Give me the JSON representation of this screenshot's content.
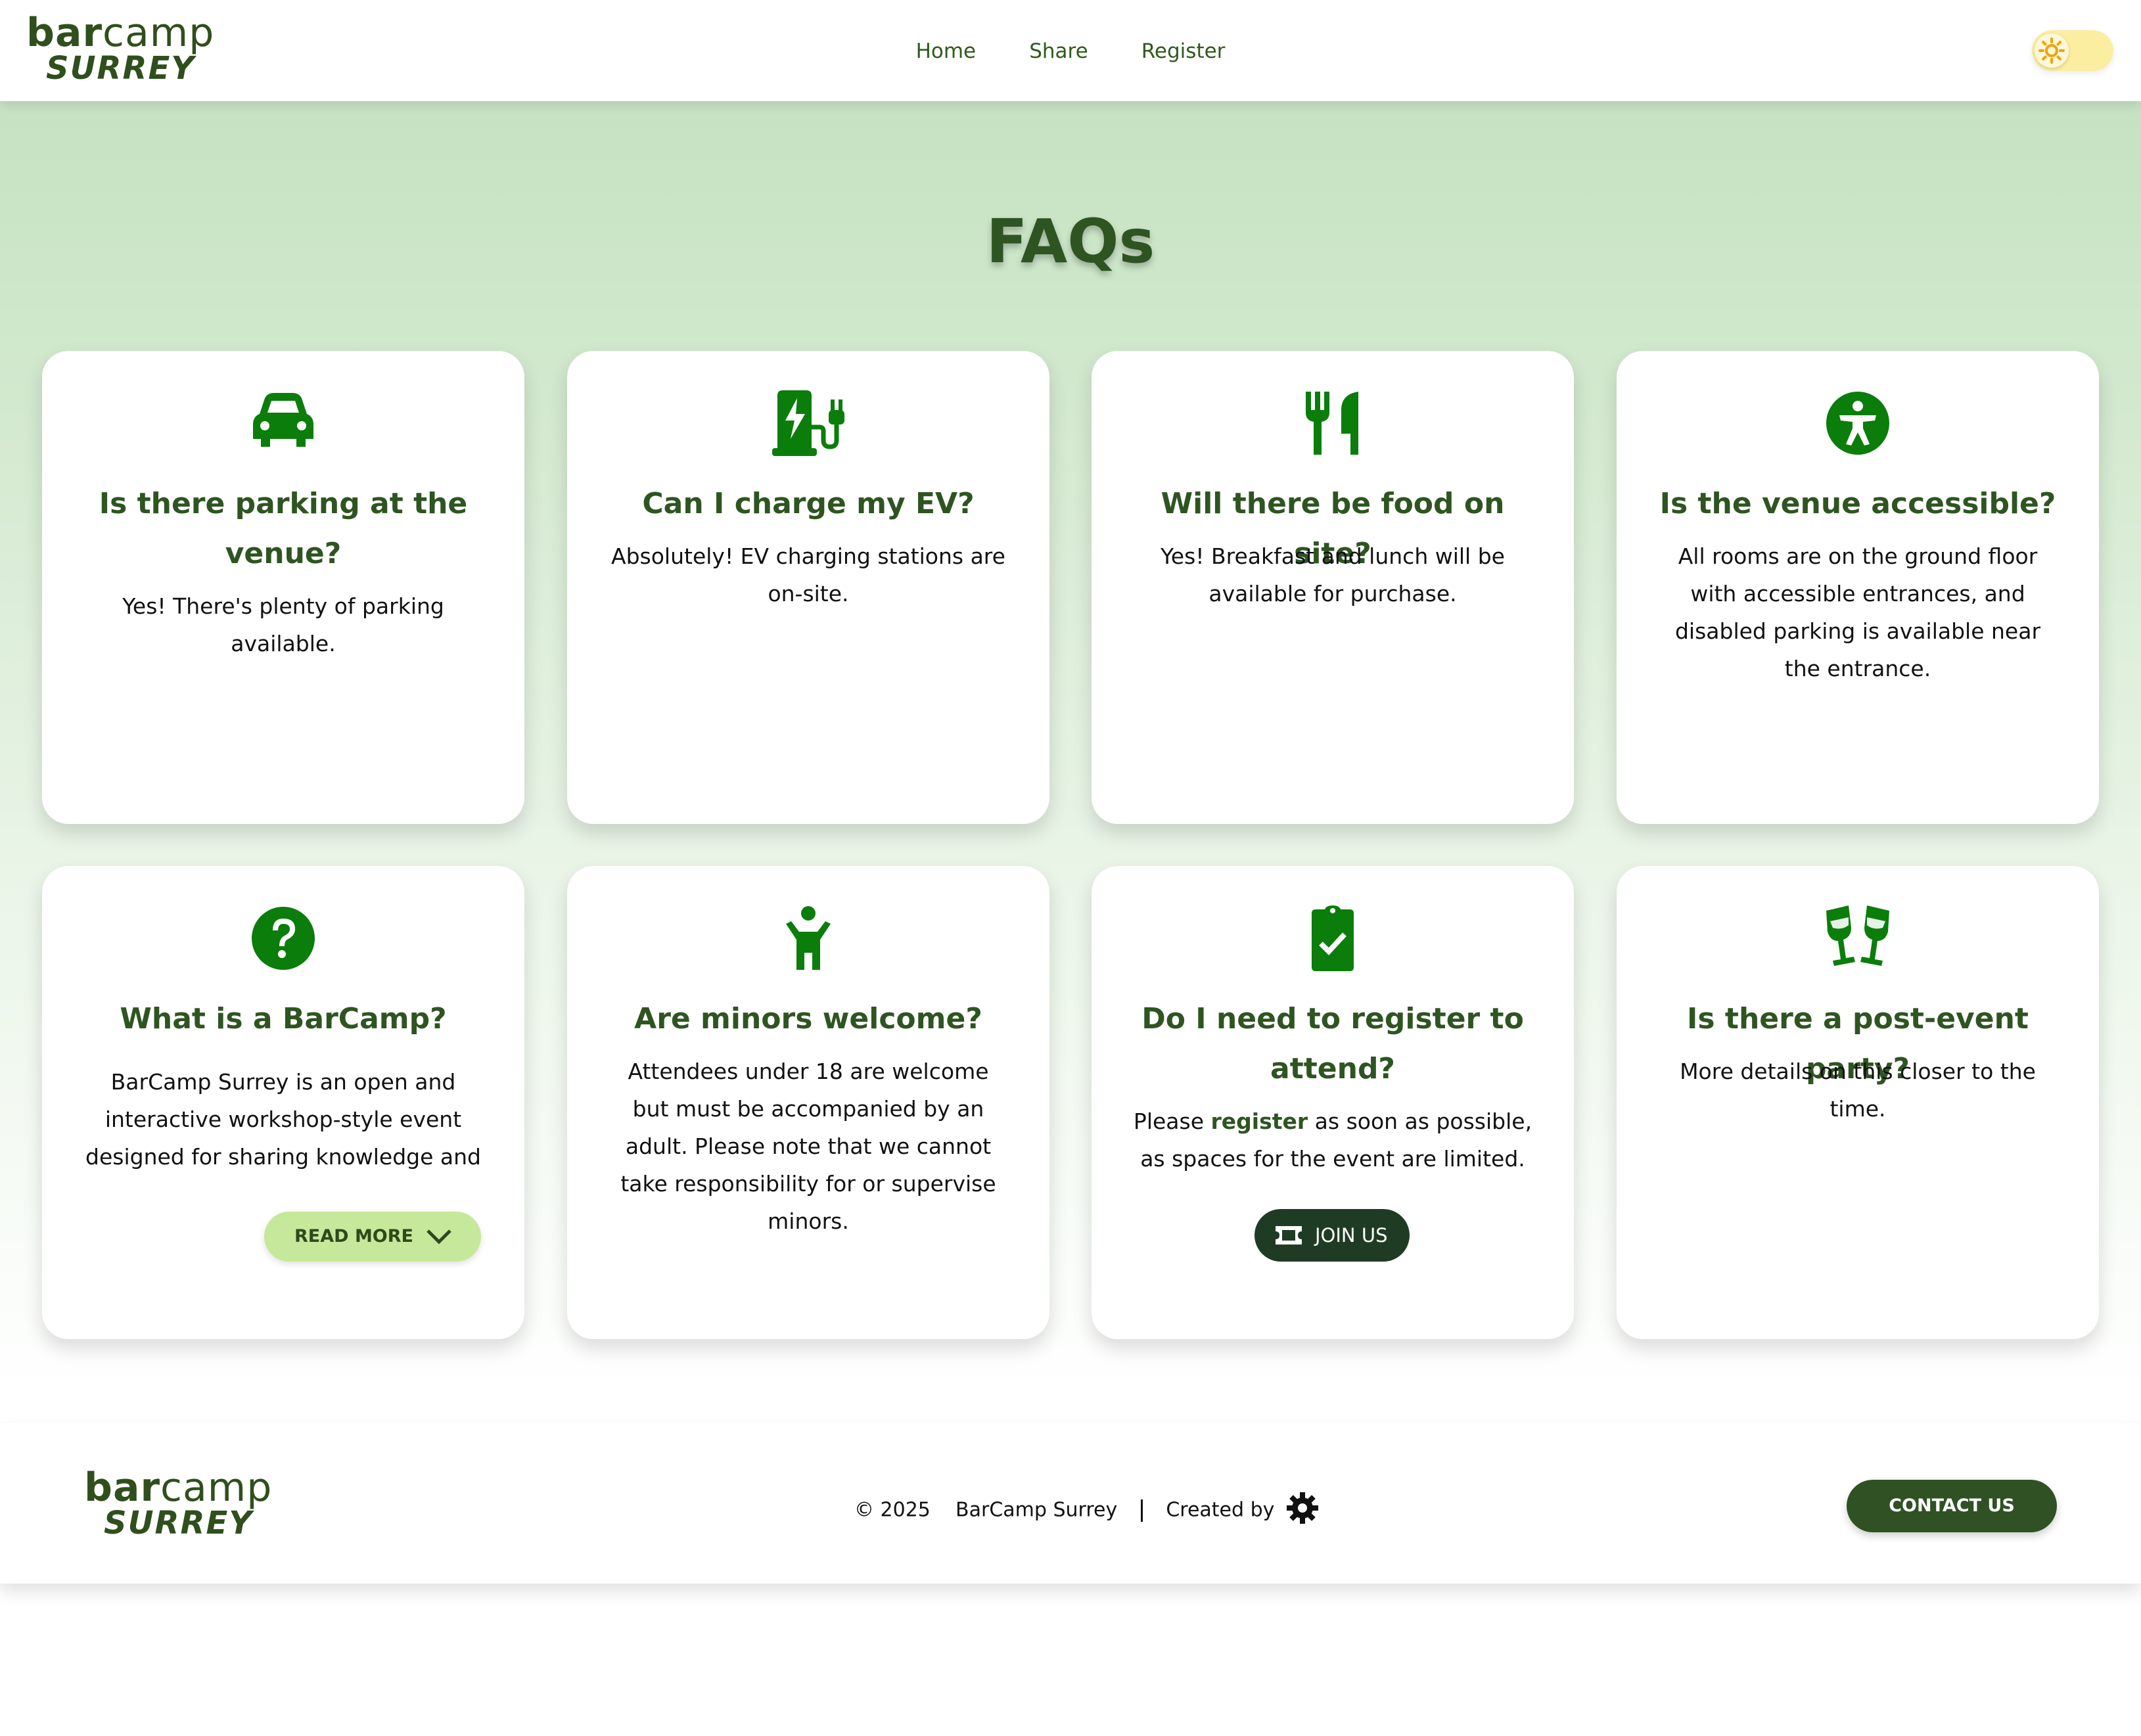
{
  "header": {
    "logo_top": "bar",
    "logo_top_rest": "camp",
    "logo_bottom": "SURREY",
    "nav": [
      "Home",
      "Share",
      "Register"
    ]
  },
  "main": {
    "title": "FAQs",
    "cards": [
      {
        "icon": "car-icon",
        "question": "Is there parking at the venue?",
        "answer": "Yes! There's plenty of parking available."
      },
      {
        "icon": "ev-charger-icon",
        "question": "Can I charge my EV?",
        "answer": "Absolutely! EV charging stations are on-site."
      },
      {
        "icon": "utensils-icon",
        "question": "Will there be food on site?",
        "answer": "Yes! Breakfast and lunch will be available for purchase."
      },
      {
        "icon": "accessibility-icon",
        "question": "Is the venue accessible?",
        "answer": "All rooms are on the ground floor with accessible entrances, and disabled parking is available near the entrance."
      },
      {
        "icon": "question-circle-icon",
        "question": "What is a BarCamp?",
        "answer": "BarCamp Surrey is an open and interactive workshop-style event designed for sharing knowledge and",
        "button": "READ MORE"
      },
      {
        "icon": "child-icon",
        "question": "Are minors welcome?",
        "answer": "Attendees under 18 are welcome but must be accompanied by an adult. Please note that we cannot take responsibility for or supervise minors."
      },
      {
        "icon": "clipboard-check-icon",
        "question": "Do I need to register to attend?",
        "answer_pre": "Please ",
        "answer_link": "register",
        "answer_post": " as soon as possible, as spaces for the event are limited.",
        "button": "JOIN US"
      },
      {
        "icon": "champagne-glasses-icon",
        "question": "Is there a post-event party?",
        "answer": "More details on this closer to the time."
      }
    ]
  },
  "footer": {
    "copyright": "© 2025",
    "org": "BarCamp Surrey",
    "created_by": "Created by",
    "contact_label": "CONTACT US"
  },
  "colors": {
    "brand_green": "#2e5521",
    "icon_green": "#0b7d0b",
    "readmore_bg": "#c6e89a",
    "join_bg": "#1f3b24"
  }
}
